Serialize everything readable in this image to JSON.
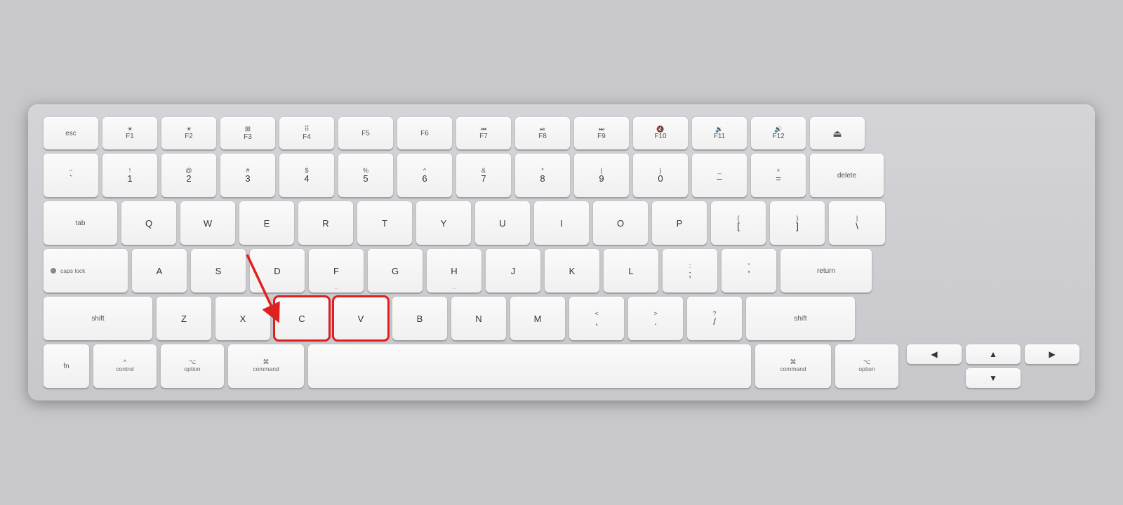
{
  "keyboard": {
    "rows": [
      {
        "id": "fn-row",
        "keys": [
          {
            "id": "esc",
            "label": "esc",
            "size": "esc"
          },
          {
            "id": "f1",
            "top": "☀",
            "label": "F1",
            "size": "fn"
          },
          {
            "id": "f2",
            "top": "☀",
            "label": "F2",
            "size": "fn"
          },
          {
            "id": "f3",
            "top": "⊞",
            "label": "F3",
            "size": "fn"
          },
          {
            "id": "f4",
            "top": "⠿",
            "label": "F4",
            "size": "fn"
          },
          {
            "id": "f5",
            "label": "F5",
            "size": "fn"
          },
          {
            "id": "f6",
            "label": "F6",
            "size": "fn"
          },
          {
            "id": "f7",
            "top": "⏮",
            "label": "F7",
            "size": "fn"
          },
          {
            "id": "f8",
            "top": "⏯",
            "label": "F8",
            "size": "fn"
          },
          {
            "id": "f9",
            "top": "⏭",
            "label": "F9",
            "size": "fn"
          },
          {
            "id": "f10",
            "top": "🔇",
            "label": "F10",
            "size": "fn"
          },
          {
            "id": "f11",
            "top": "🔉",
            "label": "F11",
            "size": "fn"
          },
          {
            "id": "f12",
            "top": "🔊",
            "label": "F12",
            "size": "fn"
          },
          {
            "id": "eject",
            "top": "⏏",
            "label": "",
            "size": "eject"
          }
        ]
      },
      {
        "id": "number-row",
        "keys": [
          {
            "id": "tilde",
            "top": "~",
            "label": "`",
            "size": "std"
          },
          {
            "id": "1",
            "top": "!",
            "label": "1",
            "size": "std"
          },
          {
            "id": "2",
            "top": "@",
            "label": "2",
            "size": "std"
          },
          {
            "id": "3",
            "top": "#",
            "label": "3",
            "size": "std"
          },
          {
            "id": "4",
            "top": "$",
            "label": "4",
            "size": "std"
          },
          {
            "id": "5",
            "top": "%",
            "label": "5",
            "size": "std"
          },
          {
            "id": "6",
            "top": "^",
            "label": "6",
            "size": "std"
          },
          {
            "id": "7",
            "top": "&",
            "label": "7",
            "size": "std"
          },
          {
            "id": "8",
            "top": "*",
            "label": "8",
            "size": "std"
          },
          {
            "id": "9",
            "top": "(",
            "label": "9",
            "size": "std"
          },
          {
            "id": "0",
            "top": ")",
            "label": "0",
            "size": "std"
          },
          {
            "id": "minus",
            "top": "_",
            "label": "–",
            "size": "std"
          },
          {
            "id": "equal",
            "top": "+",
            "label": "=",
            "size": "std"
          },
          {
            "id": "delete",
            "label": "delete",
            "size": "delete"
          }
        ]
      },
      {
        "id": "qwerty-row",
        "keys": [
          {
            "id": "tab",
            "label": "tab",
            "size": "tab"
          },
          {
            "id": "q",
            "label": "Q",
            "size": "std"
          },
          {
            "id": "w",
            "label": "W",
            "size": "std"
          },
          {
            "id": "e",
            "label": "E",
            "size": "std"
          },
          {
            "id": "r",
            "label": "R",
            "size": "std"
          },
          {
            "id": "t",
            "label": "T",
            "size": "std"
          },
          {
            "id": "y",
            "label": "Y",
            "size": "std"
          },
          {
            "id": "u",
            "label": "U",
            "size": "std"
          },
          {
            "id": "i",
            "label": "I",
            "size": "std"
          },
          {
            "id": "o",
            "label": "O",
            "size": "std"
          },
          {
            "id": "p",
            "label": "P",
            "size": "std"
          },
          {
            "id": "lbracket",
            "top": "{",
            "label": "[",
            "size": "std"
          },
          {
            "id": "rbracket",
            "top": "}",
            "label": "]",
            "size": "std"
          },
          {
            "id": "pipe",
            "top": "|",
            "label": "\\",
            "size": "pipe"
          }
        ]
      },
      {
        "id": "asdf-row",
        "keys": [
          {
            "id": "caps",
            "label": "caps lock",
            "size": "caps"
          },
          {
            "id": "a",
            "label": "A",
            "size": "std"
          },
          {
            "id": "s",
            "label": "S",
            "size": "std"
          },
          {
            "id": "d",
            "label": "D",
            "size": "std"
          },
          {
            "id": "f",
            "label": "F",
            "size": "std"
          },
          {
            "id": "g",
            "label": "G",
            "size": "std"
          },
          {
            "id": "h",
            "label": "H",
            "size": "std"
          },
          {
            "id": "j",
            "label": "J",
            "size": "std"
          },
          {
            "id": "k",
            "label": "K",
            "size": "std"
          },
          {
            "id": "l",
            "label": "L",
            "size": "std"
          },
          {
            "id": "semicolon",
            "top": ":",
            "label": ";",
            "size": "std"
          },
          {
            "id": "quote",
            "top": "\"",
            "label": "'",
            "size": "std"
          },
          {
            "id": "return",
            "label": "return",
            "size": "return"
          }
        ]
      },
      {
        "id": "zxcv-row",
        "keys": [
          {
            "id": "shift-l",
            "label": "shift",
            "size": "shift-l"
          },
          {
            "id": "z",
            "label": "Z",
            "size": "std"
          },
          {
            "id": "x",
            "label": "X",
            "size": "std"
          },
          {
            "id": "c",
            "label": "C",
            "size": "std",
            "highlight": true
          },
          {
            "id": "v",
            "label": "V",
            "size": "std",
            "highlight": true
          },
          {
            "id": "b",
            "label": "B",
            "size": "std"
          },
          {
            "id": "n",
            "label": "N",
            "size": "std"
          },
          {
            "id": "m",
            "label": "M",
            "size": "std"
          },
          {
            "id": "comma",
            "top": "<",
            "label": ",",
            "size": "std"
          },
          {
            "id": "period",
            "top": ">",
            "label": ".",
            "size": "std"
          },
          {
            "id": "slash",
            "top": "?",
            "label": "/",
            "size": "std"
          },
          {
            "id": "shift-r",
            "label": "shift",
            "size": "shift-r"
          }
        ]
      },
      {
        "id": "bottom-row",
        "keys": [
          {
            "id": "fn",
            "label": "fn",
            "size": "fn-key"
          },
          {
            "id": "control",
            "top": "^",
            "label": "control",
            "size": "control"
          },
          {
            "id": "option-l",
            "top": "⌥",
            "label": "option",
            "size": "option"
          },
          {
            "id": "command-l",
            "top": "⌘",
            "label": "command",
            "size": "command"
          },
          {
            "id": "space",
            "label": "",
            "size": "space"
          },
          {
            "id": "command-r",
            "top": "⌘",
            "label": "command",
            "size": "command"
          },
          {
            "id": "option-r",
            "top": "⌥",
            "label": "option",
            "size": "option"
          }
        ]
      }
    ],
    "highlight_keys": [
      "c",
      "v"
    ],
    "arrow_color": "#e02020"
  }
}
